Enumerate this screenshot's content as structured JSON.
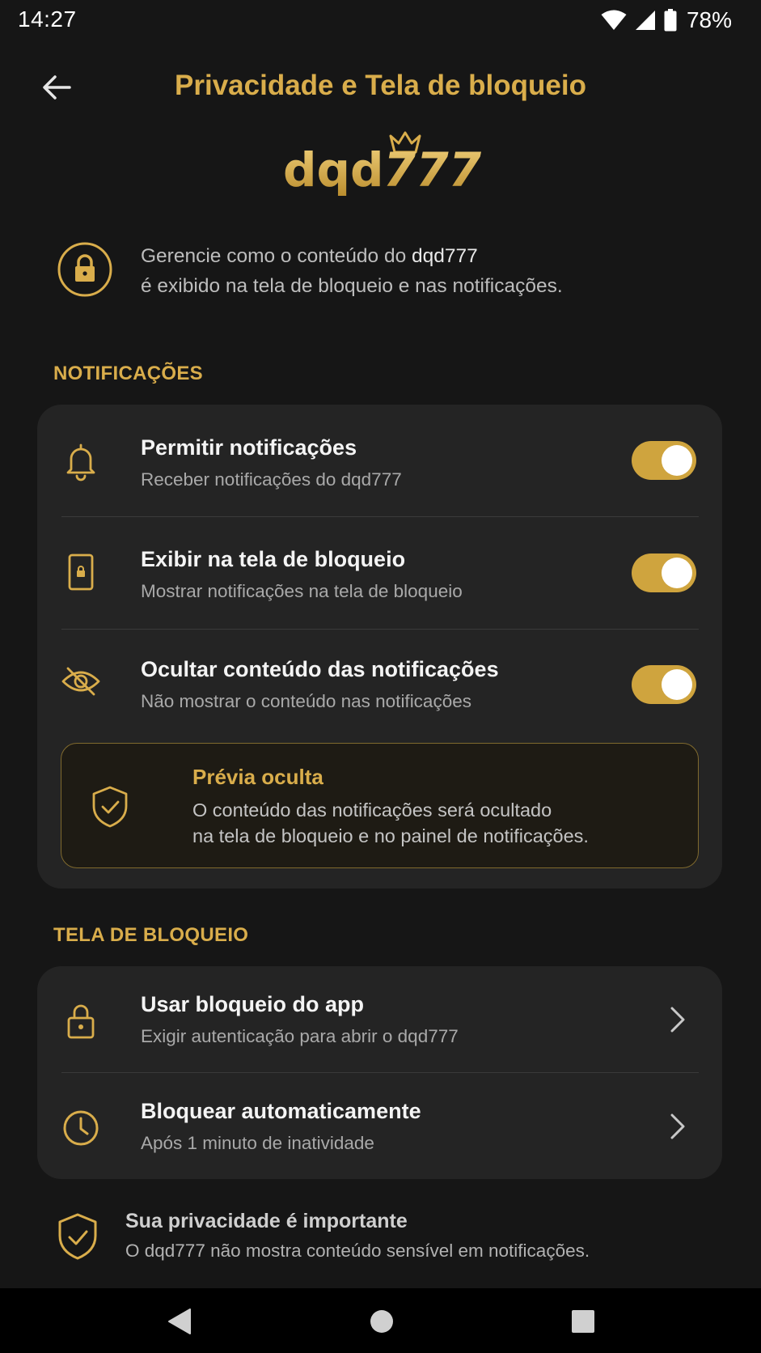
{
  "status": {
    "time": "14:27",
    "battery": "78%",
    "icons": [
      "wifi-icon",
      "signal-icon",
      "battery-icon"
    ]
  },
  "header": {
    "title": "Privacidade e Tela de bloqueio",
    "back_icon": "back-arrow-icon"
  },
  "logo": {
    "text_a": "dqd",
    "text_b": "777"
  },
  "intro": {
    "line1_prefix": "Gerencie como o conteúdo do ",
    "line1_brand": "dqd777",
    "line2": "é exibido na tela de bloqueio e nas notificações.",
    "icon": "lock-icon"
  },
  "notifications": {
    "section_label": "NOTIFICAÇÕES",
    "items": [
      {
        "title": "Permitir notificações",
        "subtitle": "Receber notificações do dqd777",
        "icon": "bell-icon",
        "enabled": true
      },
      {
        "title": "Exibir na tela de bloqueio",
        "subtitle": "Mostrar notificações na tela de bloqueio",
        "icon": "phone-lock-icon",
        "enabled": true
      },
      {
        "title": "Ocultar conteúdo das notificações",
        "subtitle": "Não mostrar o conteúdo nas notificações",
        "icon": "eye-off-icon",
        "enabled": true
      }
    ],
    "preview": {
      "title": "Prévia oculta",
      "line1": "O conteúdo das notificações será ocultado",
      "line2": "na tela de bloqueio e no painel de notificações.",
      "icon": "shield-check-icon"
    }
  },
  "lockscreen": {
    "section_label": "TELA DE BLOQUEIO",
    "items": [
      {
        "title": "Usar bloqueio do app",
        "subtitle": "Exigir autenticação para abrir o dqd777",
        "icon": "padlock-icon"
      },
      {
        "title": "Bloquear automaticamente",
        "subtitle": "Após 1 minuto de inatividade",
        "icon": "clock-icon"
      }
    ]
  },
  "footer": {
    "title": "Sua privacidade é importante",
    "subtitle": "O dqd777 não mostra conteúdo sensível em notificações.",
    "icon": "shield-check-icon"
  },
  "navbar": {
    "buttons": [
      "back-triangle-icon",
      "home-circle-icon",
      "recents-square-icon"
    ]
  },
  "colors": {
    "accent": "#d9ad4b",
    "background": "#161616",
    "card": "#242424",
    "toggle_on": "#cfa43e"
  }
}
